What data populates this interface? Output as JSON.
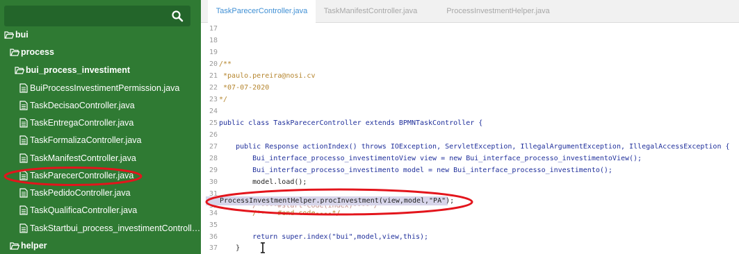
{
  "sidebar": {
    "search": {
      "value": "",
      "icon": "search-icon"
    },
    "tree": [
      {
        "label": "bui",
        "type": "folder"
      },
      {
        "label": "process",
        "type": "folder"
      },
      {
        "label": "bui_process_investiment",
        "type": "folder"
      },
      {
        "label": "BuiProcessInvestimentPermission.java",
        "type": "file"
      },
      {
        "label": "TaskDecisaoController.java",
        "type": "file"
      },
      {
        "label": "TaskEntregaController.java",
        "type": "file"
      },
      {
        "label": "TaskFormalizaController.java",
        "type": "file"
      },
      {
        "label": "TaskManifestController.java",
        "type": "file"
      },
      {
        "label": "TaskParecerController.java",
        "type": "file",
        "circled": true
      },
      {
        "label": "TaskPedidoController.java",
        "type": "file"
      },
      {
        "label": "TaskQualificaController.java",
        "type": "file"
      },
      {
        "label": "TaskStartbui_process_investimentController.j...",
        "type": "file"
      },
      {
        "label": "helper",
        "type": "folder"
      }
    ]
  },
  "tabs": [
    {
      "label": "TaskParecerController.java",
      "active": true
    },
    {
      "label": "TaskManifestController.java",
      "active": false
    },
    {
      "label": "ProcessInvestmentHelper.java",
      "active": false
    }
  ],
  "editor": {
    "lines": [
      {
        "num": "17",
        "code": ""
      },
      {
        "num": "18",
        "code": ""
      },
      {
        "num": "19",
        "code": ""
      },
      {
        "num": "20",
        "code": "/**"
      },
      {
        "num": "21",
        "code": " *paulo.pereira@nosi.cv"
      },
      {
        "num": "22",
        "code": " *07-07-2020"
      },
      {
        "num": "23",
        "code": "*/"
      },
      {
        "num": "24",
        "code": ""
      },
      {
        "num": "25",
        "code": "public class TaskParecerController extends BPMNTaskController {"
      },
      {
        "num": "26",
        "code": ""
      },
      {
        "num": "27",
        "code": "    public Response actionIndex() throws IOException, ServletException, IllegalArgumentException, IllegalAccessException {"
      },
      {
        "num": "28",
        "code": "        Bui_interface_processo_investimentoView view = new Bui_interface_processo_investimentoView();"
      },
      {
        "num": "29",
        "code": "        Bui_interface_processo_investimento model = new Bui_interface_processo_investimento();"
      },
      {
        "num": "30",
        "code": "        model.load();"
      },
      {
        "num": "31",
        "code": ""
      },
      {
        "num": "32",
        "code": "        /*----#start-code(index)----*/"
      },
      {
        "num": "",
        "code": "ProcessInvestmentHelper.procInvestment(view,model,\"PA\");"
      },
      {
        "num": "34",
        "code": "        /*----#end-code----*/"
      },
      {
        "num": "35",
        "code": ""
      },
      {
        "num": "36",
        "code": "        return super.index(\"bui\",model,view,this);"
      },
      {
        "num": "37",
        "code": "    }"
      }
    ]
  },
  "colors": {
    "sidebar_bg": "#2f7a33",
    "annotation_red": "#e3151c",
    "tab_active_text": "#3f8fd4",
    "selection_bg": "#d7d5ea"
  }
}
